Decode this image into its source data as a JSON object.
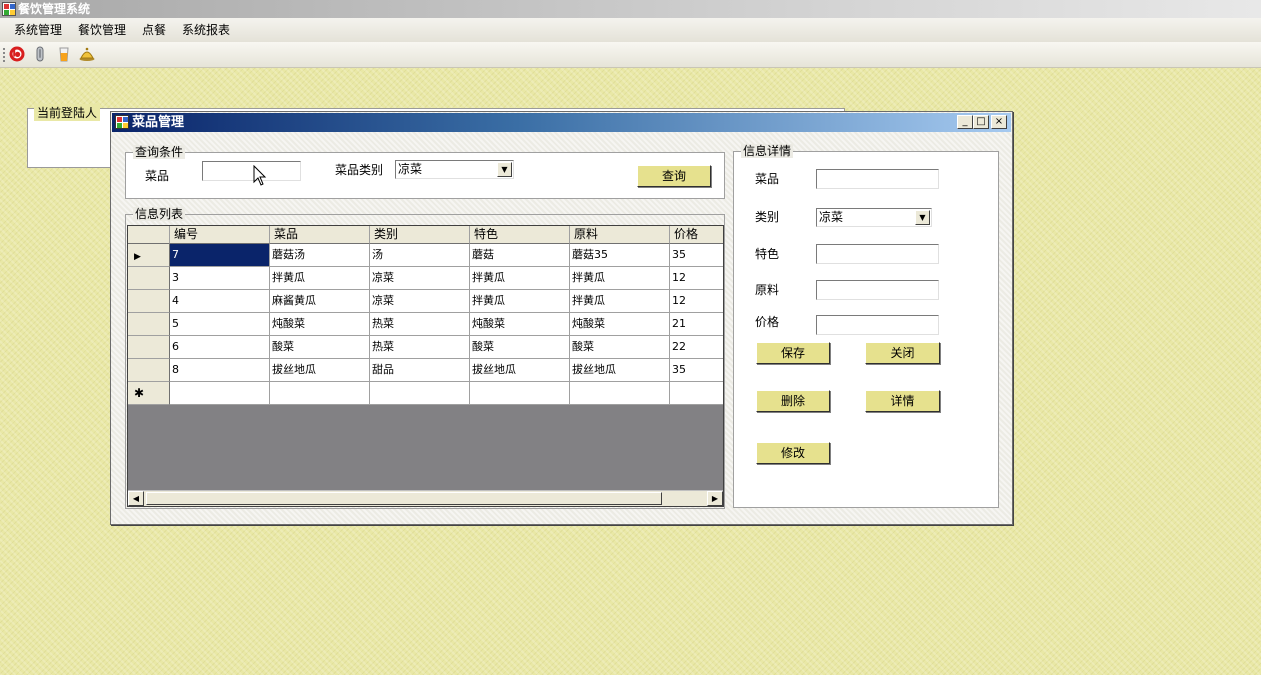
{
  "window": {
    "title": "餐饮管理系统"
  },
  "menu": {
    "items": [
      "系统管理",
      "餐饮管理",
      "点餐",
      "系统报表"
    ]
  },
  "toolbar": {
    "icons": [
      "beats-icon",
      "clip-icon",
      "drink-icon",
      "bell-icon"
    ]
  },
  "login": {
    "label": "当前登陆人"
  },
  "child": {
    "title": "菜品管理",
    "controls": {
      "minimize": "_",
      "maximize": "□",
      "close": "×"
    }
  },
  "query": {
    "group_label": "查询条件",
    "dish_label": "菜品",
    "dish_value": "",
    "category_label": "菜品类别",
    "category_value": "凉菜",
    "button": "查询"
  },
  "list": {
    "group_label": "信息列表",
    "columns": [
      "编号",
      "菜品",
      "类别",
      "特色",
      "原料",
      "价格"
    ],
    "rows": [
      [
        "7",
        "蘑菇汤",
        "汤",
        "蘑菇",
        "蘑菇35",
        "35"
      ],
      [
        "3",
        "拌黄瓜",
        "凉菜",
        "拌黄瓜",
        "拌黄瓜",
        "12"
      ],
      [
        "4",
        "麻酱黄瓜",
        "凉菜",
        "拌黄瓜",
        "拌黄瓜",
        "12"
      ],
      [
        "5",
        "炖酸菜",
        "热菜",
        "炖酸菜",
        "炖酸菜",
        "21"
      ],
      [
        "6",
        "酸菜",
        "热菜",
        "酸菜",
        "酸菜",
        "22"
      ],
      [
        "8",
        "拔丝地瓜",
        "甜品",
        "拔丝地瓜",
        "拔丝地瓜",
        "35"
      ]
    ],
    "current_row_marker": "▶",
    "new_row_marker": "✱"
  },
  "detail": {
    "group_label": "信息详情",
    "dish_label": "菜品",
    "dish_value": "",
    "category_label": "类别",
    "category_value": "凉菜",
    "feature_label": "特色",
    "feature_value": "",
    "ingredient_label": "原料",
    "ingredient_value": "",
    "price_label": "价格",
    "price_value": "",
    "buttons": {
      "save": "保存",
      "close": "关闭",
      "delete": "删除",
      "details": "详情",
      "modify": "修改"
    }
  }
}
